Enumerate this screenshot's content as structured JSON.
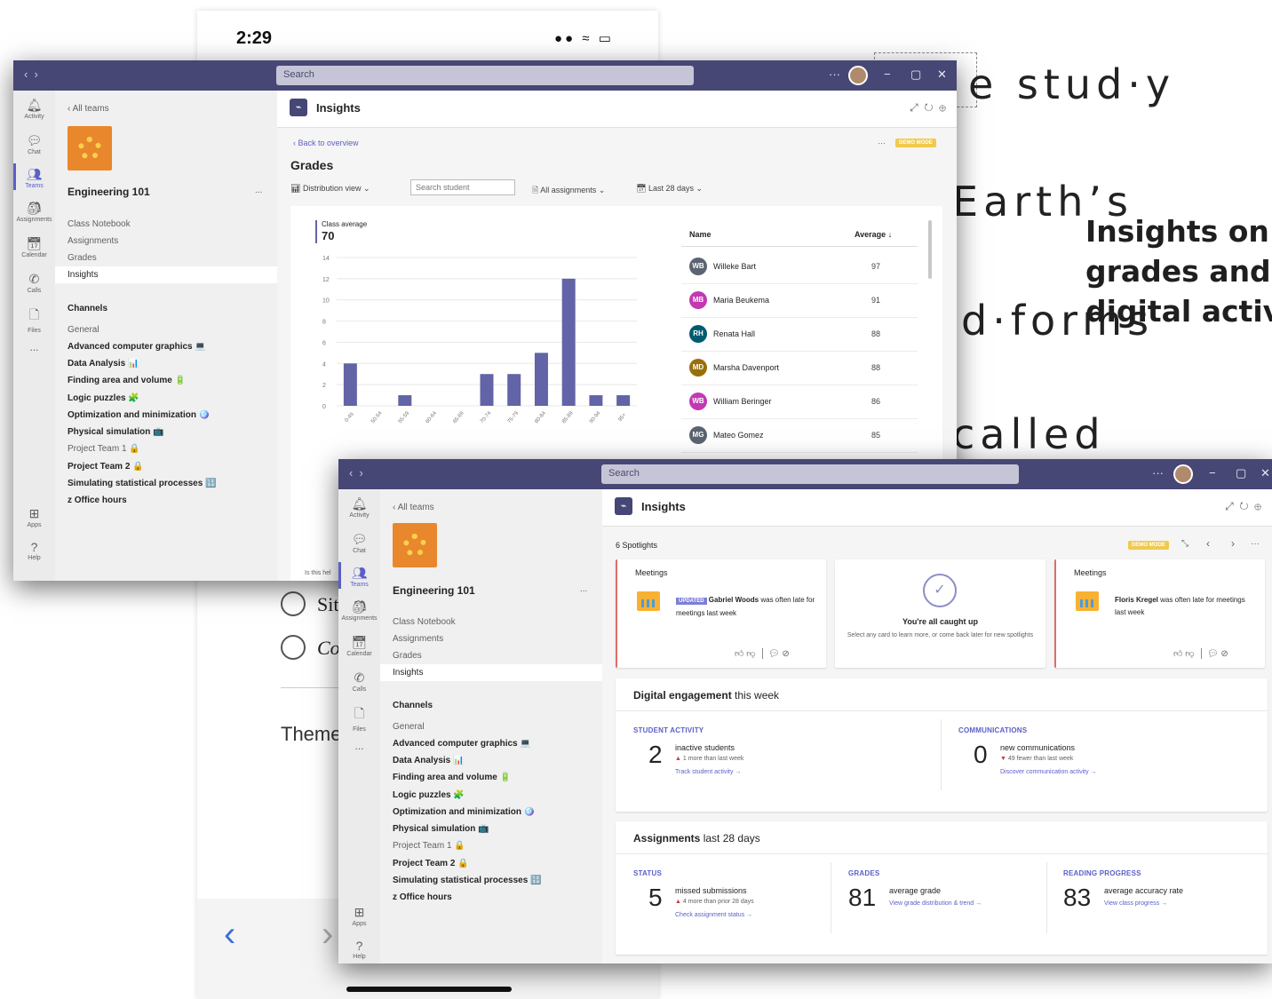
{
  "background_doc": {
    "words": [
      "e stud·y",
      "Earth’s",
      "d·forms",
      "called"
    ],
    "callout": [
      "Insights on",
      "grades and",
      "digital activity"
    ]
  },
  "phone": {
    "time": "2:29",
    "status_icons": "●● ≈ ▭",
    "options": [
      "Sit",
      "Co"
    ],
    "theme_label": "Theme",
    "back_arrow": "‹",
    "fwd_arrow": "›"
  },
  "app_rail": [
    "Activity",
    "Chat",
    "Teams",
    "Assignments",
    "Calendar",
    "Calls",
    "Files",
    "...",
    "Apps",
    "Help"
  ],
  "sidebar": {
    "back": "All teams",
    "team_name": "Engineering 101",
    "more": "...",
    "items": [
      "Class Notebook",
      "Assignments",
      "Grades",
      "Insights"
    ],
    "channels_header": "Channels",
    "channels": [
      {
        "name": "General",
        "bold": false,
        "emoji": ""
      },
      {
        "name": "Advanced computer graphics",
        "bold": true,
        "emoji": "💻"
      },
      {
        "name": "Data Analysis",
        "bold": true,
        "emoji": "📊"
      },
      {
        "name": "Finding area and volume",
        "bold": true,
        "emoji": "🔋"
      },
      {
        "name": "Logic puzzles",
        "bold": true,
        "emoji": "🧩"
      },
      {
        "name": "Optimization and minimization",
        "bold": true,
        "emoji": "🪩"
      },
      {
        "name": "Physical simulation",
        "bold": true,
        "emoji": "📺"
      },
      {
        "name": "Project Team 1",
        "bold": false,
        "emoji": "🔒"
      },
      {
        "name": "Project Team 2",
        "bold": true,
        "emoji": "🔒"
      },
      {
        "name": "Simulating statistical processes",
        "bold": true,
        "emoji": "🔢"
      },
      {
        "name": "z Office hours",
        "bold": true,
        "emoji": ""
      }
    ]
  },
  "window1": {
    "search_placeholder": "Search",
    "title": "Insights",
    "back_to_overview": "Back to overview",
    "demo_mode": "DEMO MODE",
    "page_title": "Grades",
    "toolbar": {
      "view": "Distribution view",
      "search_student": "Search student",
      "assignments": "All assignments",
      "range": "Last 28 days"
    },
    "helpful": "Is this hel",
    "table": {
      "col_name": "Name",
      "col_avg": "Average ↓",
      "rows": [
        {
          "initials": "WB",
          "name": "Willeke Bart",
          "avg": "97",
          "color": "#5b6470"
        },
        {
          "initials": "MB",
          "name": "Maria Beukema",
          "avg": "91",
          "color": "#c239b3"
        },
        {
          "initials": "RH",
          "name": "Renata Hall",
          "avg": "88",
          "color": "#005b70"
        },
        {
          "initials": "MD",
          "name": "Marsha Davenport",
          "avg": "88",
          "color": "#986f0b"
        },
        {
          "initials": "WB",
          "name": "William Beringer",
          "avg": "86",
          "color": "#c239b3"
        },
        {
          "initials": "MG",
          "name": "Mateo Gomez",
          "avg": "85",
          "color": "#5b6470"
        }
      ]
    }
  },
  "chart_data": {
    "type": "bar",
    "title": "Class average",
    "subtitle": "70",
    "categories": [
      "0-49",
      "50-54",
      "55-59",
      "60-64",
      "65-69",
      "70-74",
      "75-79",
      "80-84",
      "85-89",
      "90-94",
      "95+"
    ],
    "values": [
      4,
      0,
      1,
      0,
      0,
      3,
      3,
      5,
      12,
      1,
      1
    ],
    "yticks": [
      0,
      2,
      4,
      6,
      8,
      10,
      12,
      14
    ],
    "ylim": [
      0,
      14
    ],
    "grid": true,
    "color": "#6264a7"
  },
  "window2": {
    "search_placeholder": "Search",
    "title": "Insights",
    "spotlights_count": "6 Spotlights",
    "demo_mode": "DEMO MODE",
    "card_left": {
      "header": "Meetings",
      "badge": "UPDATED",
      "person": "Gabriel Woods",
      "text": "was often late for meetings last week"
    },
    "card_center": {
      "title": "You're all caught up",
      "sub": "Select any card to learn more, or come back later for new spotlights"
    },
    "card_right": {
      "header": "Meetings",
      "person": "Floris Kregel",
      "text": "was often late for meetings last week"
    },
    "digital": {
      "title_bold": "Digital engagement",
      "title_rest": "this week",
      "activity_label": "STUDENT ACTIVITY",
      "activity_num": "2",
      "activity_text": "inactive students",
      "activity_trend": "1 more than last week",
      "activity_link": "Track student activity →",
      "comm_label": "COMMUNICATIONS",
      "comm_num": "0",
      "comm_text": "new communications",
      "comm_trend": "49 fewer than last week",
      "comm_link": "Discover communication activity →"
    },
    "assignments": {
      "title_bold": "Assignments",
      "title_rest": "last 28 days",
      "status_label": "STATUS",
      "status_num": "5",
      "status_text": "missed submissions",
      "status_trend": "4 more than prior 28 days",
      "status_link": "Check assignment status →",
      "grades_label": "GRADES",
      "grades_num": "81",
      "grades_text": "average grade",
      "grades_link": "View grade distribution & trend →",
      "reading_label": "READING PROGRESS",
      "reading_num": "83",
      "reading_text": "average accuracy rate",
      "reading_link": "View class progress →"
    }
  }
}
